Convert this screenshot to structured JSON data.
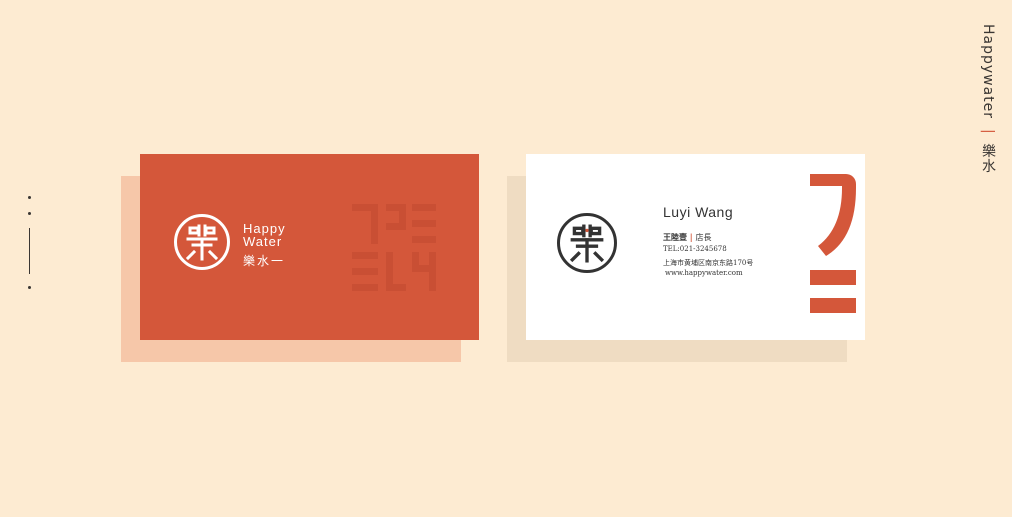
{
  "brand_side": {
    "en": "Happywater",
    "separator": "|",
    "cn": "樂水"
  },
  "front_card": {
    "logo_glyph": "樂",
    "en_line1": "Happy",
    "en_line2": "Water",
    "cn": "樂水一"
  },
  "back_card": {
    "logo_glyph": "樂",
    "name": "Luyi Wang",
    "cn_name": "王陸壹",
    "role_sep": "|",
    "role": "店長",
    "tel": "TEL:021-3245678",
    "address": "上海市黄埔区南京东路170号",
    "website": "www.happywater.com"
  },
  "colors": {
    "background": "#fdebd2",
    "brand_red": "#d4573a",
    "dark": "#333333"
  }
}
